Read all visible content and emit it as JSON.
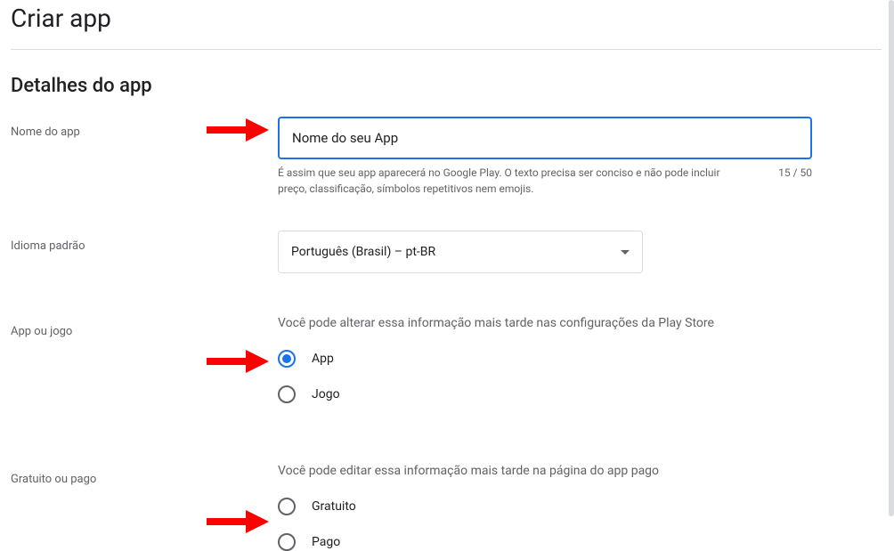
{
  "page": {
    "title": "Criar app",
    "section_title": "Detalhes do app"
  },
  "appName": {
    "label": "Nome do app",
    "value": "Nome do seu App",
    "helper": "É assim que seu app aparecerá no Google Play. O texto precisa ser conciso e não pode incluir preço, classificação, símbolos repetitivos nem emojis.",
    "counter": "15 / 50"
  },
  "language": {
    "label": "Idioma padrão",
    "selected": "Português (Brasil) – pt-BR"
  },
  "appOrGame": {
    "label": "App ou jogo",
    "hint": "Você pode alterar essa informação mais tarde nas configurações da Play Store",
    "options": {
      "app": "App",
      "game": "Jogo"
    }
  },
  "pricing": {
    "label": "Gratuito ou pago",
    "hint": "Você pode editar essa informação mais tarde na página do app pago",
    "options": {
      "free": "Gratuito",
      "paid": "Pago"
    }
  }
}
